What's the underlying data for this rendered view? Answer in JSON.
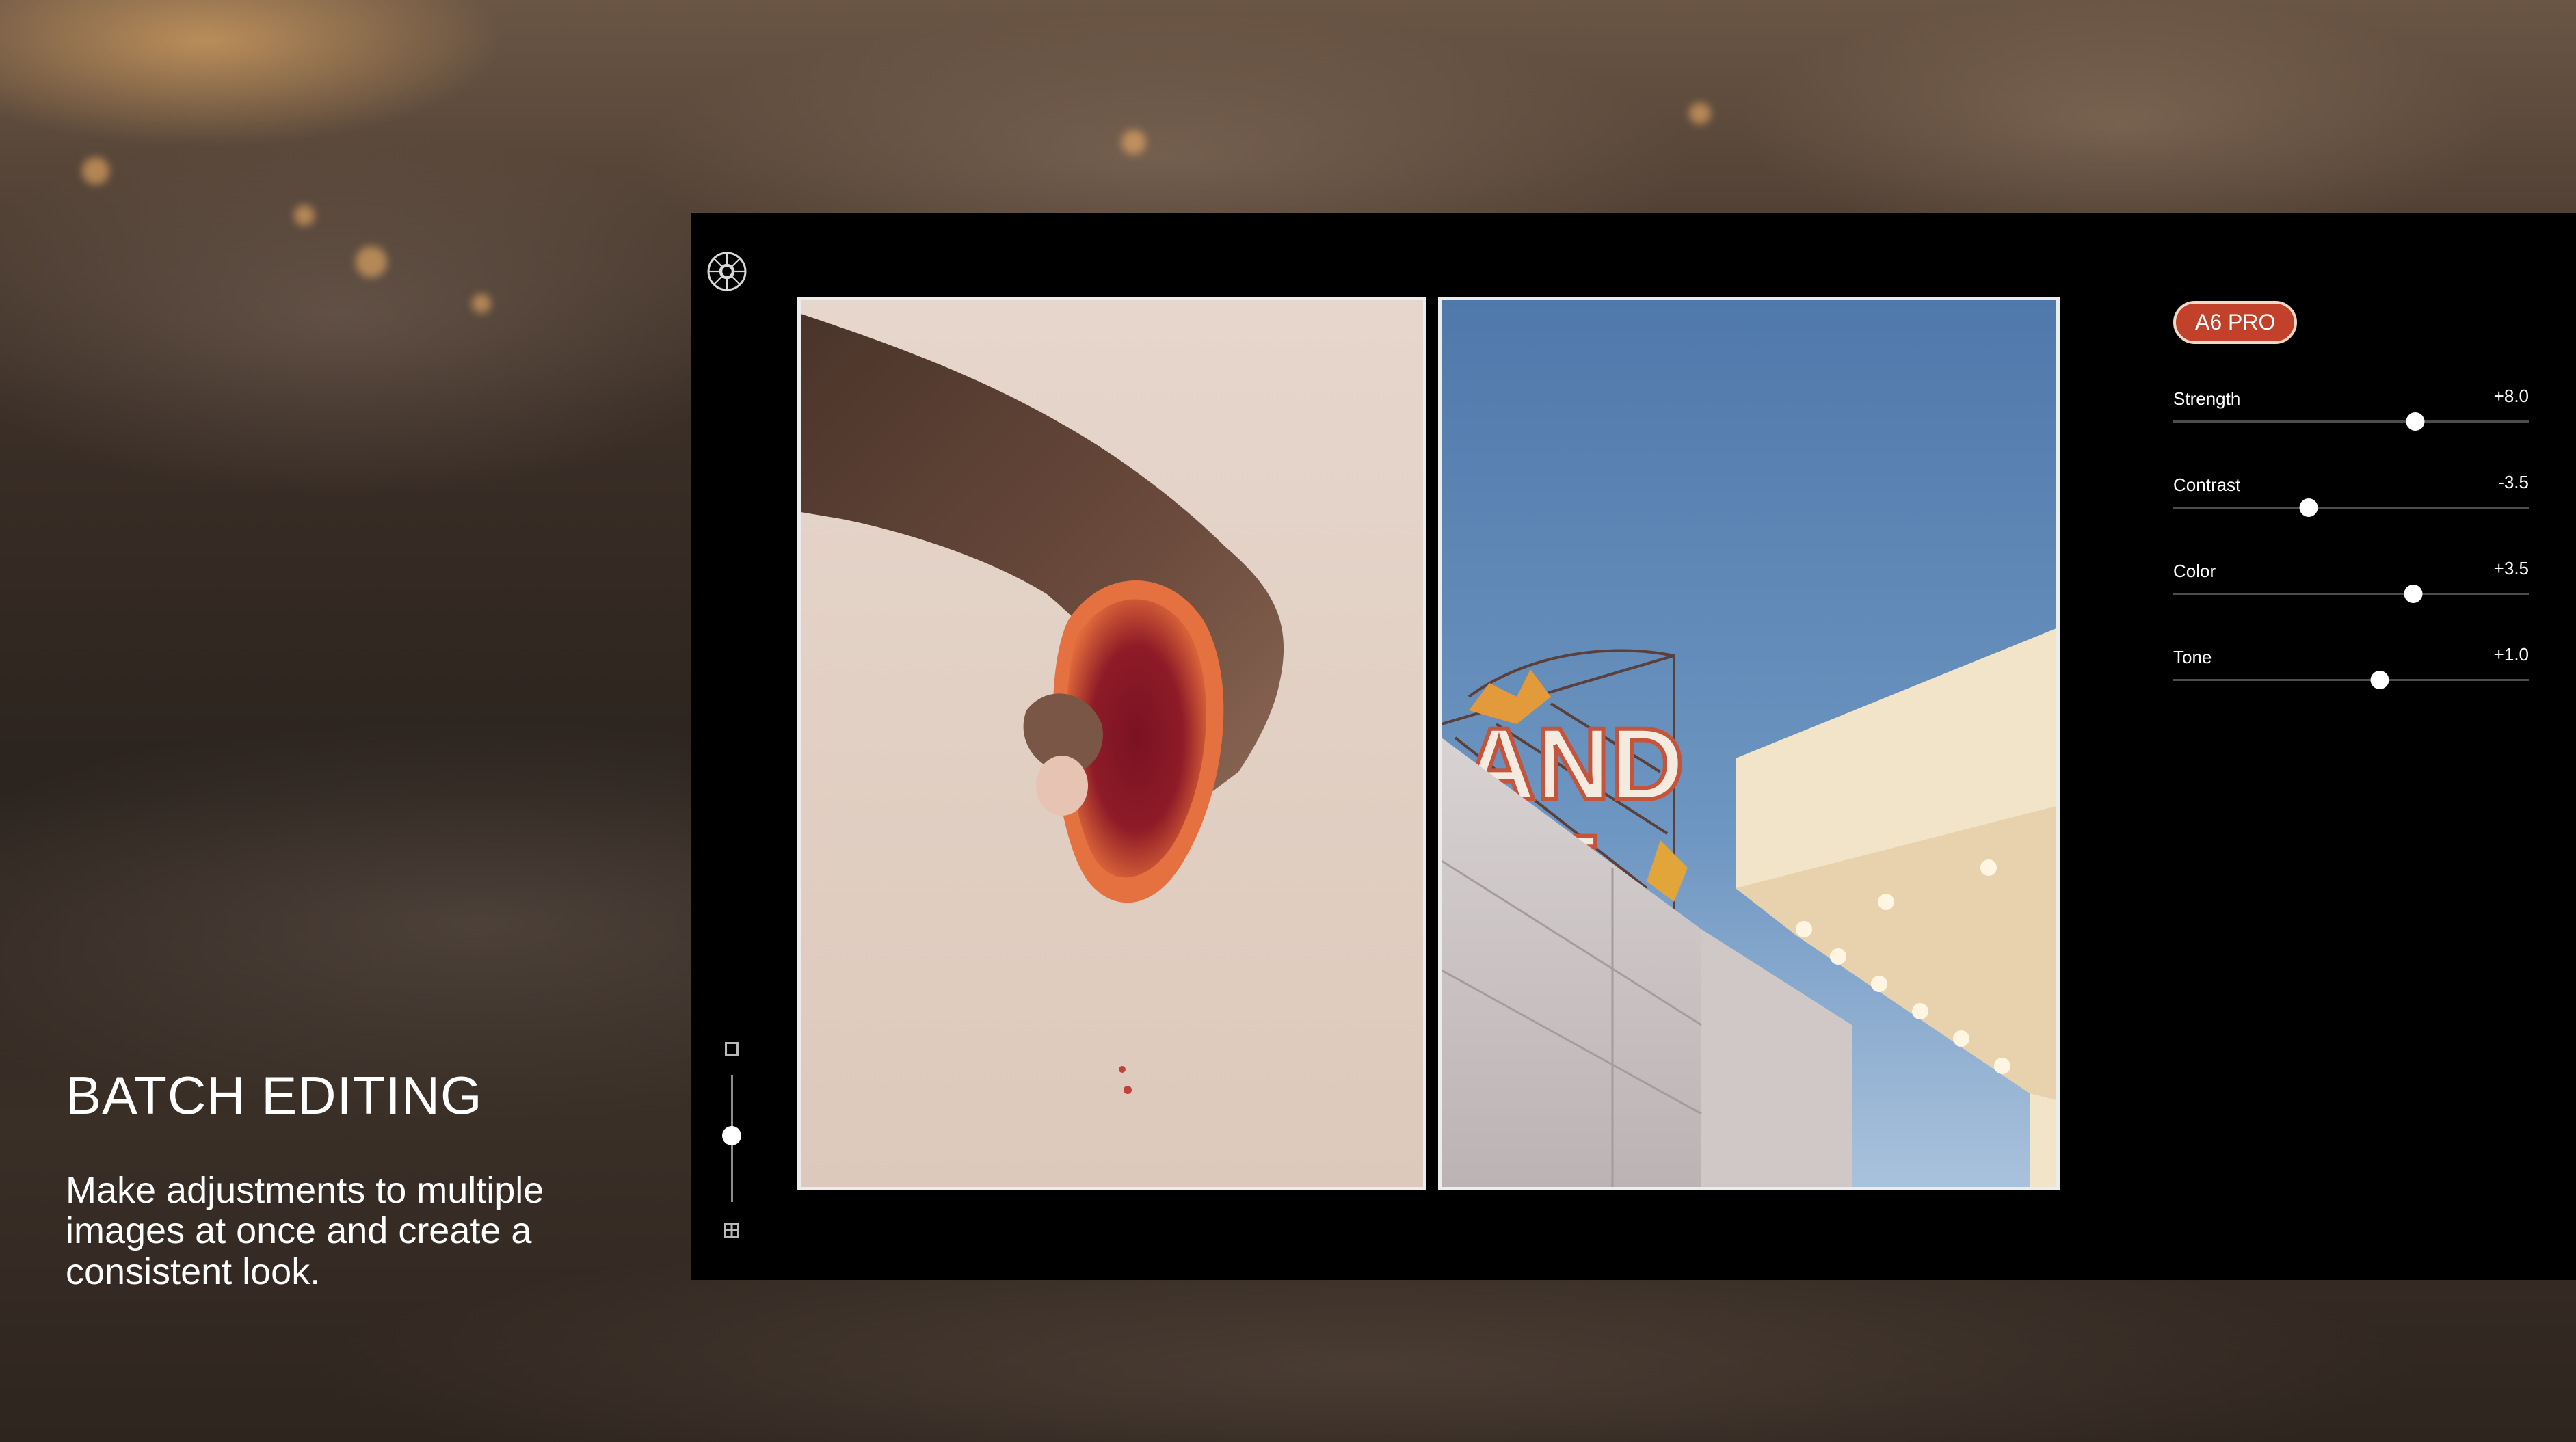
{
  "promo": {
    "heading": "BATCH EDITING",
    "description": "Make adjustments to multiple images at once and create a consistent look."
  },
  "app": {
    "logo_icon": "vsco-logo-icon",
    "zoom": {
      "single_view_icon": "single-view-icon",
      "grid_view_icon": "grid-view-icon",
      "level": 0.52
    },
    "photos": [
      {
        "subject": "hand-squeezing-blood-orange"
      },
      {
        "subject": "grand-hotel-neon-sign"
      }
    ],
    "panel": {
      "preset": "A6 PRO",
      "preset_color": "#c2412b",
      "sliders": [
        {
          "label": "Strength",
          "value": "+8.0",
          "position": 0.68
        },
        {
          "label": "Contrast",
          "value": "-3.5",
          "position": 0.38
        },
        {
          "label": "Color",
          "value": "+3.5",
          "position": 0.675
        },
        {
          "label": "Tone",
          "value": "+1.0",
          "position": 0.58
        }
      ]
    }
  }
}
